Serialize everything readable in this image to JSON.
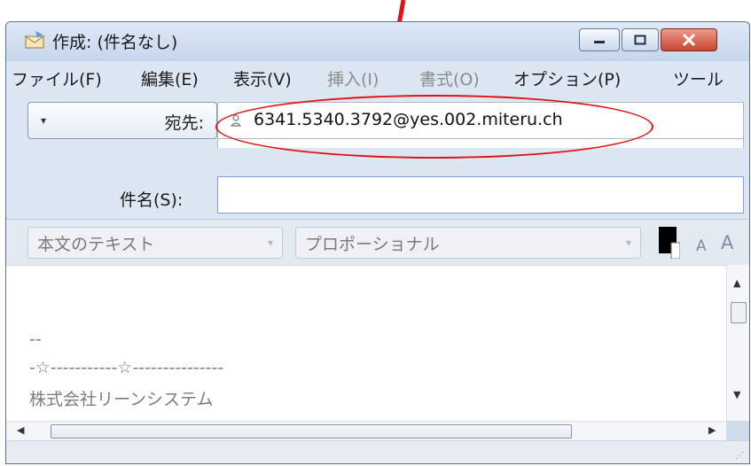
{
  "window": {
    "title": "作成: (件名なし)"
  },
  "menu": [
    {
      "label": "ファイル(F)",
      "enabled": true
    },
    {
      "label": "編集(E)",
      "enabled": true
    },
    {
      "label": "表示(V)",
      "enabled": true
    },
    {
      "label": "挿入(I)",
      "enabled": false
    },
    {
      "label": "書式(O)",
      "enabled": false
    },
    {
      "label": "オプション(P)",
      "enabled": true
    },
    {
      "label": "ツール",
      "enabled": true
    }
  ],
  "header": {
    "to_label": "宛先:",
    "to_value": "6341.5340.3792@yes.002.miteru.ch",
    "subject_label": "件名(S):",
    "subject_value": ""
  },
  "format": {
    "style_select": "本文のテキスト",
    "font_select": "プロポーショナル",
    "text_color": "#000000",
    "grow_glyph": "A",
    "shrink_glyph": "A"
  },
  "body": {
    "lines": [
      "--",
      "-☆-----------☆---------------",
      "株式会社リーンシステム"
    ]
  },
  "colors": {
    "annotation": "#e01414"
  }
}
